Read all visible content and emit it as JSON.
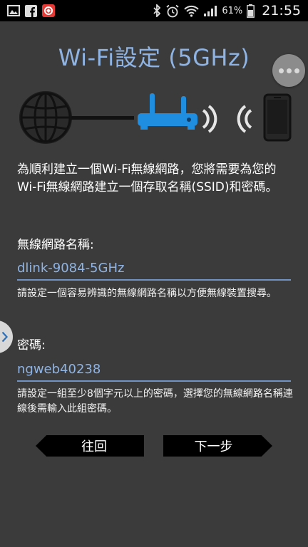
{
  "status_bar": {
    "icons_left": [
      "gallery-icon",
      "facebook-icon",
      "app-icon"
    ],
    "icons_right": [
      "bluetooth-icon",
      "alarm-icon",
      "wifi-icon",
      "signal-icon"
    ],
    "battery": "61%",
    "time": "21:55"
  },
  "header": {
    "title": "Wi-Fi設定 (5GHz)"
  },
  "diagram": {
    "icons": [
      "globe-icon",
      "router-icon",
      "phone-icon"
    ],
    "accent_color": "#1f8ee0"
  },
  "intro": {
    "text": "為順利建立一個Wi-Fi無線網路，您將需要為您的Wi-Fi無線網路建立一個存取名稱(SSID)和密碼。"
  },
  "ssid": {
    "label": "無線網路名稱:",
    "value": "dlink-9084-5GHz",
    "hint": "請設定一個容易辨識的無線網路名稱以方便無線裝置搜尋。"
  },
  "password": {
    "label": "密碼:",
    "value": "ngweb40238",
    "hint": "請設定一組至少8個字元以上的密碼，選擇您的無線網路名稱連線後需輸入此組密碼。"
  },
  "buttons": {
    "back": "往回",
    "next": "下一步"
  },
  "colors": {
    "title": "#8fb4e3",
    "field_underline": "#6e93c4",
    "background": "#3b3b3b"
  }
}
